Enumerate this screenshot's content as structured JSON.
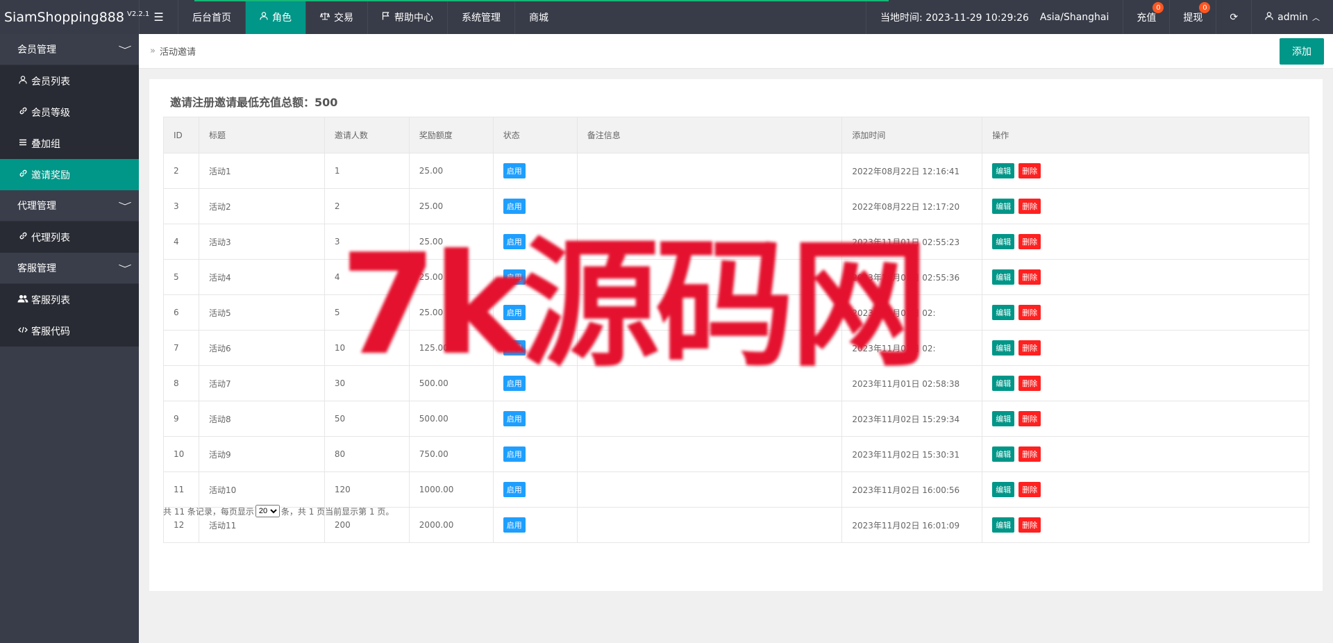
{
  "header": {
    "brand": "SiamShopping888",
    "version": "V2.2.1",
    "nav": [
      {
        "label": "后台首页",
        "icon": ""
      },
      {
        "label": "角色",
        "icon": "user-icon",
        "active": true
      },
      {
        "label": "交易",
        "icon": "scale-icon"
      },
      {
        "label": "帮助中心",
        "icon": "flag-icon"
      },
      {
        "label": "系统管理",
        "icon": ""
      },
      {
        "label": "商城",
        "icon": ""
      }
    ],
    "time_label": "当地时间: 2023-11-29 10:29:26",
    "timezone": "Asia/Shanghai",
    "recharge_label": "充值",
    "recharge_count": "0",
    "withdraw_label": "提现",
    "withdraw_count": "0",
    "user": "admin",
    "accent": "#009688"
  },
  "sidebar": {
    "groups": [
      {
        "label": "会员管理",
        "items": [
          {
            "label": "会员列表",
            "icon": "user-icon"
          },
          {
            "label": "会员等级",
            "icon": "link-icon"
          },
          {
            "label": "叠加组",
            "icon": "list-icon"
          },
          {
            "label": "邀请奖励",
            "icon": "link-icon",
            "active": true
          }
        ]
      },
      {
        "label": "代理管理",
        "items": [
          {
            "label": "代理列表",
            "icon": "link-icon"
          }
        ]
      },
      {
        "label": "客服管理",
        "items": [
          {
            "label": "客服列表",
            "icon": "users-icon"
          },
          {
            "label": "客服代码",
            "icon": "code-icon"
          }
        ]
      }
    ]
  },
  "breadcrumb": "活动邀请",
  "add_button": "添加",
  "card_title": "邀请注册邀请最低充值总额：500",
  "table": {
    "columns": [
      "ID",
      "标题",
      "邀请人数",
      "奖励额度",
      "状态",
      "备注信息",
      "添加时间",
      "操作"
    ],
    "rows": [
      {
        "id": "2",
        "title": "活动1",
        "count": "1",
        "reward": "25.00",
        "status": "启用",
        "note": "",
        "time": "2022年08月22日 12:16:41"
      },
      {
        "id": "3",
        "title": "活动2",
        "count": "2",
        "reward": "25.00",
        "status": "启用",
        "note": "",
        "time": "2022年08月22日 12:17:20"
      },
      {
        "id": "4",
        "title": "活动3",
        "count": "3",
        "reward": "25.00",
        "status": "启用",
        "note": "",
        "time": "2023年11月01日 02:55:23"
      },
      {
        "id": "5",
        "title": "活动4",
        "count": "4",
        "reward": "25.00",
        "status": "启用",
        "note": "",
        "time": "2023年11月01日 02:55:36"
      },
      {
        "id": "6",
        "title": "活动5",
        "count": "5",
        "reward": "25.00",
        "status": "启用",
        "note": "",
        "time": "2023年11月01日 02:"
      },
      {
        "id": "7",
        "title": "活动6",
        "count": "10",
        "reward": "125.00",
        "status": "启用",
        "note": "",
        "time": "2023年11月01日 02:"
      },
      {
        "id": "8",
        "title": "活动7",
        "count": "30",
        "reward": "500.00",
        "status": "启用",
        "note": "",
        "time": "2023年11月01日 02:58:38"
      },
      {
        "id": "9",
        "title": "活动8",
        "count": "50",
        "reward": "500.00",
        "status": "启用",
        "note": "",
        "time": "2023年11月02日 15:29:34"
      },
      {
        "id": "10",
        "title": "活动9",
        "count": "80",
        "reward": "750.00",
        "status": "启用",
        "note": "",
        "time": "2023年11月02日 15:30:31"
      },
      {
        "id": "11",
        "title": "活动10",
        "count": "120",
        "reward": "1000.00",
        "status": "启用",
        "note": "",
        "time": "2023年11月02日 16:00:56"
      },
      {
        "id": "12",
        "title": "活动11",
        "count": "200",
        "reward": "2000.00",
        "status": "启用",
        "note": "",
        "time": "2023年11月02日 16:01:09"
      }
    ],
    "edit_label": "编辑",
    "delete_label": "删除"
  },
  "pager": {
    "prefix": "共 11 条记录，每页显示",
    "page_size": "20",
    "suffix": "条，共 1 页当前显示第 1 页。"
  },
  "watermark": "7k源码网"
}
